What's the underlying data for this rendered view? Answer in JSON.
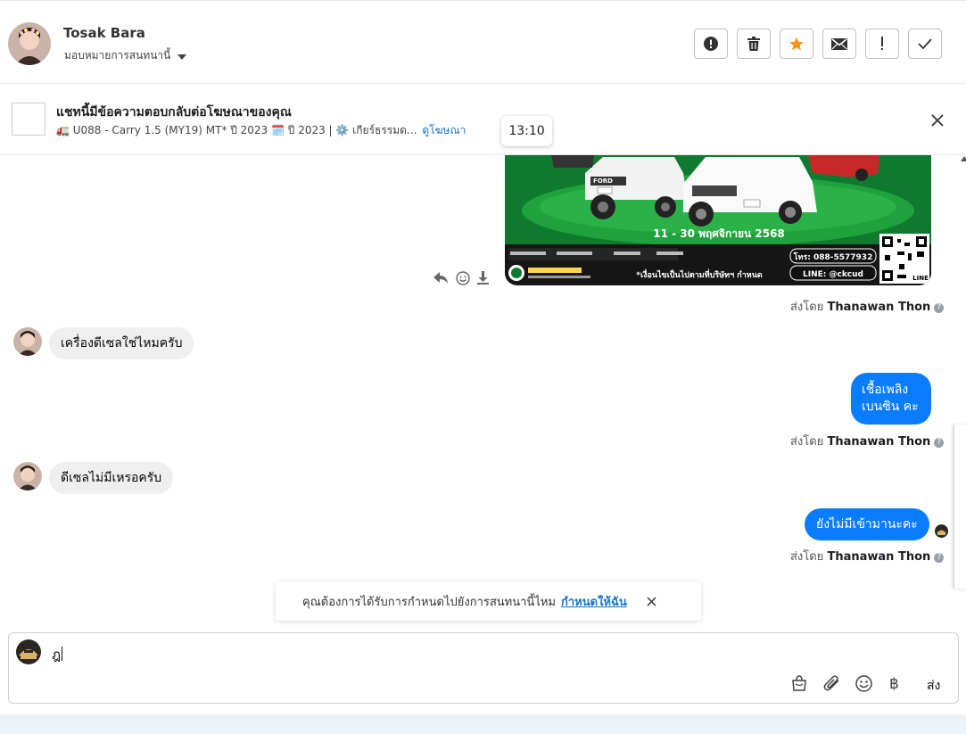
{
  "header": {
    "contact_name": "Tosak Bara",
    "assign_label": "มอบหมายการสนทนานี้"
  },
  "ad_bar": {
    "title": "แชทนี้มีข้อความตอบกลับต่อโฆษณาของคุณ",
    "subtitle": "🚛 U088 - Carry 1.5 (MY19) MT* ปี 2023 🗓️ ปี 2023 | ⚙️ เกียร์ธรรมด...",
    "link": "ดูโฆษณา"
  },
  "tooltip": {
    "time": "13:10"
  },
  "ad_image": {
    "date_text": "11 - 30 พฤศจิกายน 2568",
    "phone": "โทร: 088-5577932",
    "line_id": "LINE: @ckcud",
    "qr_label": "LINE",
    "footer_note": "*เงื่อนไขเป็นไปตามที่บริษัทฯ กำหนด",
    "plate_text": "FORD"
  },
  "messages": [
    {
      "sender_prefix": "ส่งโดย",
      "sender": "Thanawan Thon"
    },
    {
      "text": "เครื่องดีเซลใช่ไหมครับ"
    },
    {
      "text_line1": "เชื้อเพลิง",
      "text_line2": "เบนซิน คะ",
      "sender_prefix": "ส่งโดย",
      "sender": "Thanawan Thon"
    },
    {
      "text": "ดีเซลไม่มีเหรอครับ"
    },
    {
      "text": "ยังไม่มีเข้ามานะคะ",
      "sender_prefix": "ส่งโดย",
      "sender": "Thanawan Thon"
    }
  ],
  "notice": {
    "text": "คุณต้องการได้รับการกำหนดไปยังการสนทนานี้ไหม",
    "link": "กำหนดให้ฉัน"
  },
  "composer": {
    "value": "ฎ",
    "send_label": "ส่ง"
  },
  "colors": {
    "accent": "#0a7cff",
    "link": "#1a73c8",
    "star": "#f7941d"
  }
}
